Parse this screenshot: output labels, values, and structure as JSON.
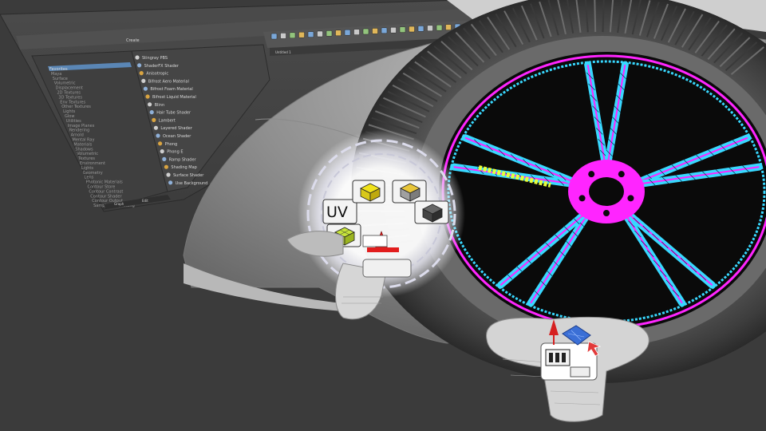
{
  "hypershade": {
    "tab_label": "Create",
    "tree_items": [
      "Favorites",
      "Maya",
      "Surface",
      "Volumetric",
      "Displacement",
      "2D Textures",
      "3D Textures",
      "Env Textures",
      "Other Textures",
      "Lights",
      "Glow",
      "Utilities",
      "Image Planes",
      "Rendering",
      "Arnold",
      "Mental Ray",
      "Materials",
      "Shadows",
      "Volumetric",
      "Textures",
      "Environment",
      "Lights",
      "Geometry",
      "Lens",
      "Photonic Materials",
      "Contour Store",
      "Contour Contrast",
      "Contour Shader",
      "Contour Output",
      "Sample Compositing"
    ],
    "shader_items": [
      "Stingray PBS",
      "ShaderFX Shader",
      "Anisotropic",
      "Bifrost Aero Material",
      "Bifrost Foam Material",
      "Bifrost Liquid Material",
      "Blinn",
      "Hair Tube Shader",
      "Lambert",
      "Layered Shader",
      "Ocean Shader",
      "Phong",
      "Phong E",
      "Ramp Shader",
      "Shading Map",
      "Surface Shader",
      "Use Background"
    ],
    "footer_buttons": [
      "Graph",
      "Edit"
    ],
    "viewport_tab": "Untitled 1"
  },
  "radial_menu": {
    "center_label": "UV",
    "items": [
      {
        "name": "face-select",
        "color": "#f0e21a"
      },
      {
        "name": "object-select",
        "color": "#e8c63a"
      },
      {
        "name": "shaded-mode",
        "color": "#555555"
      },
      {
        "name": "uv-grid-select",
        "color": "#c6e33a"
      }
    ]
  },
  "tool_palette": {
    "items": [
      "move-tool",
      "scale-tool",
      "uv-layout-tool",
      "select-cursor"
    ]
  },
  "colors": {
    "wireframe_cyan": "#38d8ff",
    "wireframe_magenta": "#ff25ff",
    "wireframe_yellow": "#e6ff3a",
    "tire_gray": "#4a4a4a",
    "fender_gray": "#9a9a9a"
  }
}
